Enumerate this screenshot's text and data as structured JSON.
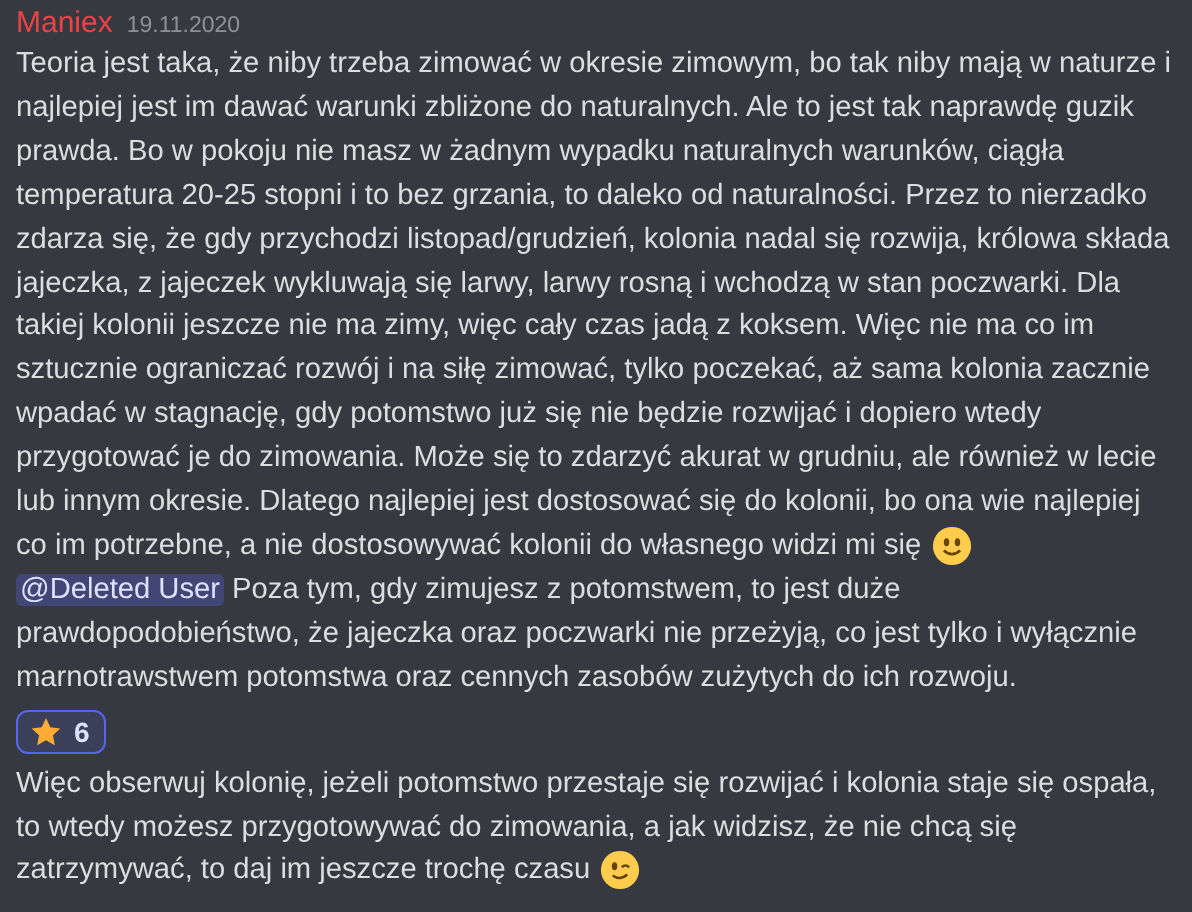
{
  "message": {
    "author": "Maniex",
    "timestamp": "19.11.2020",
    "paragraphs": [
      {
        "parts": [
          {
            "kind": "text",
            "text": "Teoria jest taka, że niby trzeba zimować w okresie zimowym, bo tak niby mają w naturze i najlepiej jest im dawać warunki zbliżone do naturalnych. Ale to jest tak naprawdę guzik prawda. Bo w pokoju nie masz w żadnym wypadku naturalnych warunków, ciągła temperatura 20-25 stopni i to bez grzania, to daleko od naturalności. Przez to nierzadko zdarza się, że gdy przychodzi listopad/grudzień, kolonia nadal się rozwija, królowa składa jajeczka, z jajeczek wykluwają się larwy, larwy rosną i wchodzą w stan poczwarki. Dla takiej kolonii jeszcze nie ma zimy, więc cały czas jadą z koksem. Więc nie ma co im sztucznie ograniczać rozwój i na siłę zimować, tylko poczekać, aż sama kolonia zacznie wpadać w stagnację, gdy potomstwo już się nie będzie rozwijać i dopiero wtedy przygotować je do zimowania. Może się to zdarzyć akurat w grudniu, ale również w lecie lub innym okresie. Dlatego najlepiej jest dostosować się do kolonii, bo ona wie najlepiej co im potrzebne, a nie dostosowywać kolonii do własnego widzi mi się"
          },
          {
            "kind": "emoji_smile"
          },
          {
            "kind": "mention",
            "text": "@Deleted User"
          },
          {
            "kind": "text",
            "text": "Poza tym, gdy zimujesz z potomstwem, to jest duże prawdopodobieństwo, że jajeczka oraz poczwarki nie przeżyją, co jest tylko i wyłącznie marnotrawstwem potomstwa oraz cennych zasobów zużytych do ich rozwoju."
          }
        ],
        "reaction": {
          "count": "6",
          "selected": true
        }
      },
      {
        "parts": [
          {
            "kind": "text",
            "text": "Więc obserwuj kolonię, jeżeli potomstwo przestaje się rozwijać i kolonia staje się ospała, to wtedy możesz przygotowywać do zimowania, a jak widzisz, że nie chcą się zatrzymywać, to daj im jeszcze trochę czasu"
          },
          {
            "kind": "emoji_wink"
          }
        ]
      }
    ]
  }
}
